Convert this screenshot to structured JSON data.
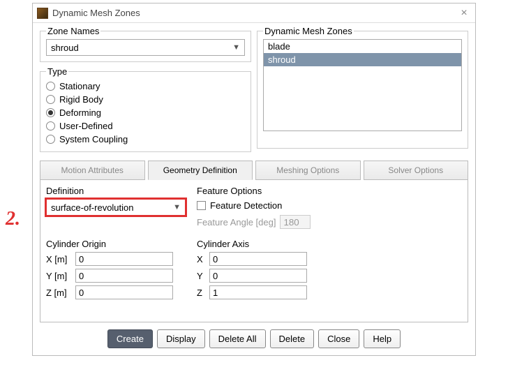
{
  "window_title": "Dynamic Mesh Zones",
  "callout_label": "2.",
  "zone_names": {
    "group_label": "Zone Names",
    "selected": "shroud"
  },
  "type": {
    "group_label": "Type",
    "options": {
      "stationary": "Stationary",
      "rigid_body": "Rigid Body",
      "deforming": "Deforming",
      "user_defined": "User-Defined",
      "system_coupling": "System Coupling"
    },
    "selected": "deforming"
  },
  "dmz": {
    "group_label": "Dynamic Mesh Zones",
    "items": [
      "blade",
      "shroud"
    ],
    "selected": "shroud"
  },
  "tabs": {
    "motion": "Motion Attributes",
    "geometry": "Geometry Definition",
    "meshing": "Meshing Options",
    "solver": "Solver Options",
    "active": "geometry"
  },
  "definition": {
    "label": "Definition",
    "selected": "surface-of-revolution"
  },
  "feature_options": {
    "label": "Feature Options",
    "feature_detection_label": "Feature Detection",
    "feature_detection_checked": false,
    "angle_label": "Feature Angle [deg]",
    "angle_value": "180"
  },
  "cylinder_origin": {
    "label": "Cylinder Origin",
    "x_label": "X [m]",
    "y_label": "Y [m]",
    "z_label": "Z [m]",
    "x": "0",
    "y": "0",
    "z": "0"
  },
  "cylinder_axis": {
    "label": "Cylinder Axis",
    "x_label": "X",
    "y_label": "Y",
    "z_label": "Z",
    "x": "0",
    "y": "0",
    "z": "1"
  },
  "buttons": {
    "create": "Create",
    "display": "Display",
    "delete_all": "Delete All",
    "delete": "Delete",
    "close": "Close",
    "help": "Help"
  }
}
